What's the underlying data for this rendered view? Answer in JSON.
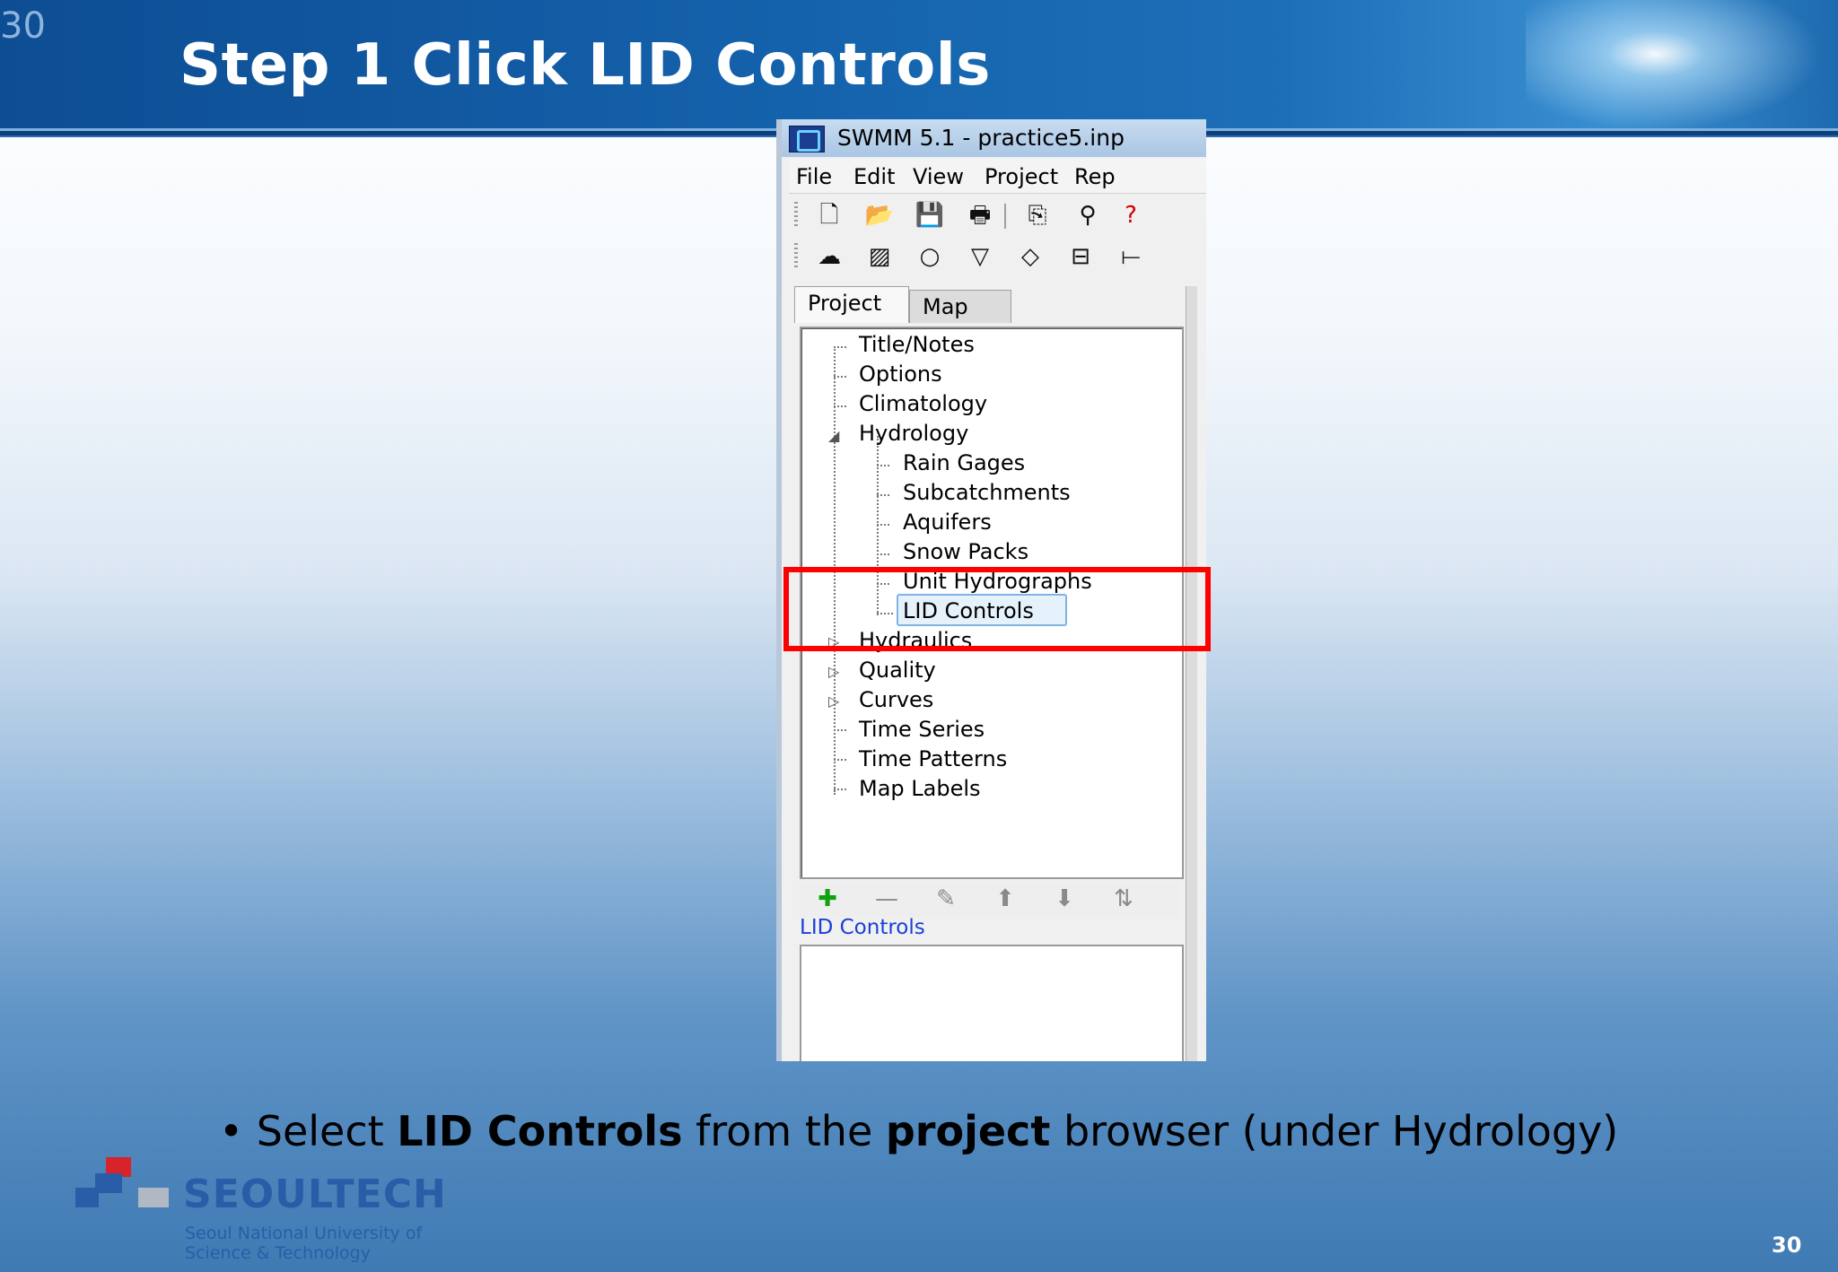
{
  "slide": {
    "number_top": "30",
    "title": "Step 1 Click LID Controls",
    "bullet_prefix": "Select ",
    "bullet_bold1": "LID Controls",
    "bullet_mid": " from the ",
    "bullet_bold2": "project",
    "bullet_suffix": " browser (under Hydrology)",
    "page_number": "30"
  },
  "logo": {
    "name": "SEOULTECH",
    "sub1": "Seoul National University of",
    "sub2": "Science & Technology"
  },
  "window": {
    "title": "SWMM 5.1 - practice5.inp",
    "menus": [
      "File",
      "Edit",
      "View",
      "Project",
      "Rep"
    ],
    "tabs": {
      "project": "Project",
      "map": "Map"
    },
    "tree": {
      "title_notes": "Title/Notes",
      "options": "Options",
      "climatology": "Climatology",
      "hydrology": "Hydrology",
      "rain_gages": "Rain Gages",
      "subcatchments": "Subcatchments",
      "aquifers": "Aquifers",
      "snow_packs": "Snow Packs",
      "unit_hydrographs": "Unit Hydrographs",
      "lid_controls": "LID Controls",
      "hydraulics": "Hydraulics",
      "quality": "Quality",
      "curves": "Curves",
      "time_series": "Time Series",
      "time_patterns": "Time Patterns",
      "map_labels": "Map Labels"
    },
    "status_label": "LID Controls"
  },
  "colors": {
    "highlight": "#ff0000",
    "status_text": "#1a3fd6",
    "header": "#1563ad"
  }
}
